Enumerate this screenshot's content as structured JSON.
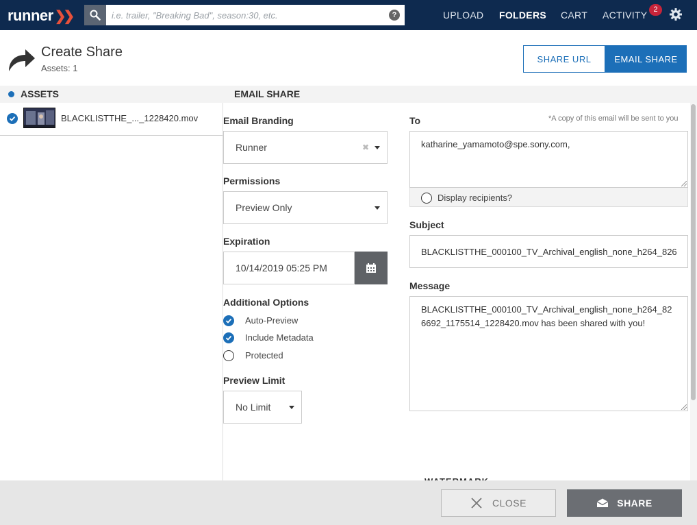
{
  "app": {
    "logo": "runner",
    "search_placeholder": "i.e. trailer, \"Breaking Bad\", season:30, etc.",
    "help_glyph": "?",
    "nav": {
      "upload": "UPLOAD",
      "folders": "FOLDERS",
      "cart": "CART",
      "activity": "ACTIVITY",
      "activity_badge": "2"
    }
  },
  "header": {
    "title": "Create Share",
    "assets_count": "Assets: 1",
    "tabs": {
      "share_url": "SHARE URL",
      "email_share": "EMAIL SHARE"
    }
  },
  "assets_panel": {
    "heading": "ASSETS",
    "items": [
      {
        "name": "BLACKLISTTHE_..._1228420.mov",
        "checked": true
      }
    ]
  },
  "email_share": {
    "heading": "EMAIL SHARE",
    "email_branding": {
      "label": "Email Branding",
      "value": "Runner"
    },
    "permissions": {
      "label": "Permissions",
      "value": "Preview Only"
    },
    "expiration": {
      "label": "Expiration",
      "value": "10/14/2019 05:25 PM"
    },
    "additional_options": {
      "label": "Additional Options",
      "options": [
        {
          "label": "Auto-Preview",
          "checked": true
        },
        {
          "label": "Include Metadata",
          "checked": true
        },
        {
          "label": "Protected",
          "checked": false
        }
      ]
    },
    "preview_limit": {
      "label": "Preview Limit",
      "value": "No Limit"
    },
    "to": {
      "label": "To",
      "note": "*A copy of this email will be sent to you",
      "value": "katharine_yamamoto@spe.sony.com,",
      "display_recipients": "Display recipients?"
    },
    "subject": {
      "label": "Subject",
      "value": "BLACKLISTTHE_000100_TV_Archival_english_none_h264_826"
    },
    "message": {
      "label": "Message",
      "line1": "BLACKLISTTHE_000100_TV_Archival_english_none_h264_82",
      "line2": "6692_1175514_1228420.mov has been shared with you!"
    },
    "watermark_heading": "WATERMARK"
  },
  "footer": {
    "close": "CLOSE",
    "share": "SHARE"
  },
  "colors": {
    "nav_bg": "#0e2a4f",
    "accent": "#1c6fb8",
    "logo_chevron": "#e8513b",
    "badge": "#c7243a"
  }
}
